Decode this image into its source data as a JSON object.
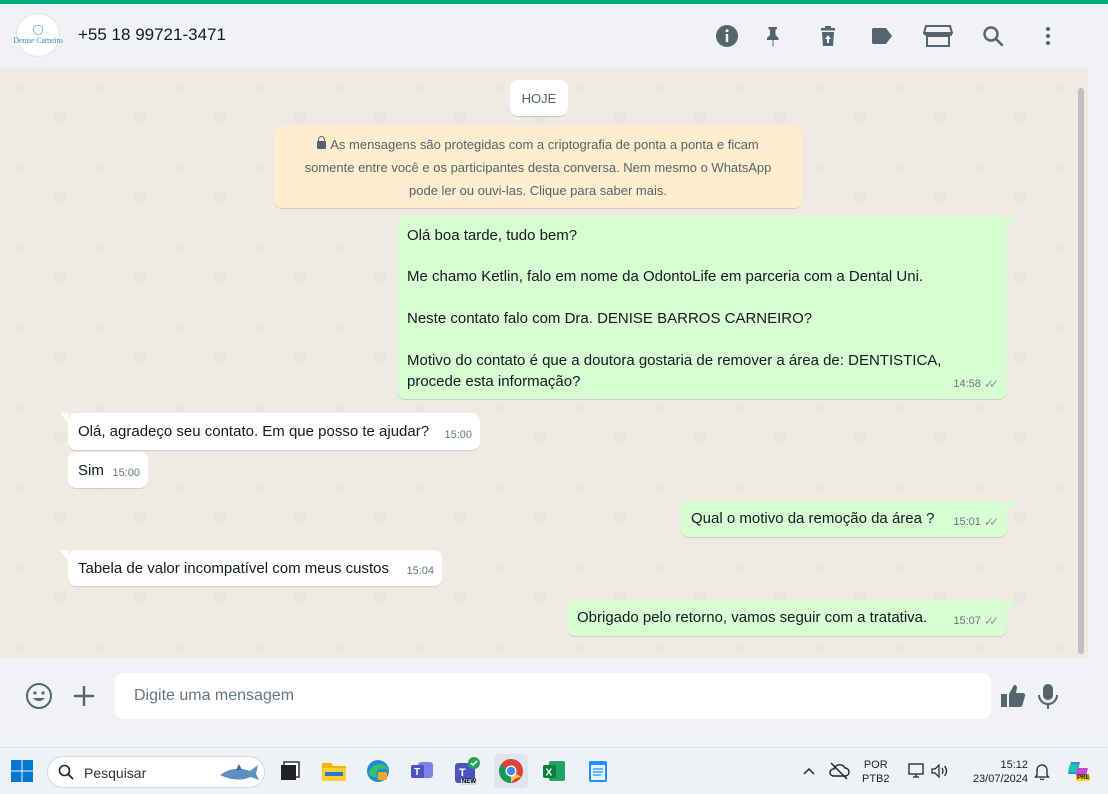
{
  "header": {
    "avatar_text": "Denise Carneiro",
    "contact_name": "+55 18 99721-3471",
    "icons": [
      "info-icon",
      "pin-icon",
      "delete-icon",
      "label-icon",
      "store-icon",
      "search-icon",
      "menu-icon"
    ]
  },
  "chat": {
    "date_label": "HOJE",
    "encryption_notice": {
      "line1": "As mensagens são protegidas com a criptografia de ponta a ponta e ficam",
      "line2": "somente entre você e os participantes desta conversa. Nem mesmo o WhatsApp",
      "line3": "pode ler ou ouvi-las. Clique para saber mais."
    },
    "messages": [
      {
        "direction": "out",
        "lines": [
          "Olá boa tarde, tudo bem?",
          "Me chamo Ketlin, falo em nome da OdontoLife em parceria com a Dental Uni.",
          "Neste contato falo com Dra. DENISE BARROS CARNEIRO?",
          "Motivo do contato é que a doutora gostaria de remover a área de: DENTISTICA,",
          "procede esta informação?"
        ],
        "time": "14:58"
      },
      {
        "direction": "in",
        "text": "Olá, agradeço seu contato. Em que posso te ajudar?",
        "time": "15:00"
      },
      {
        "direction": "in",
        "text": "Sim",
        "time": "15:00"
      },
      {
        "direction": "out",
        "text": "Qual o motivo da remoção da área ?",
        "time": "15:01"
      },
      {
        "direction": "in",
        "text": "Tabela de valor incompatível com meus custos",
        "time": "15:04"
      },
      {
        "direction": "out",
        "text": "Obrigado pelo retorno, vamos seguir com a tratativa.",
        "time": "15:07"
      }
    ]
  },
  "footer": {
    "placeholder": "Digite uma mensagem"
  },
  "taskbar": {
    "search_label": "Pesquisar",
    "language_line1": "POR",
    "language_line2": "PTB2",
    "clock_time": "15:12",
    "clock_date": "23/07/2024",
    "teams_badge": "NEW",
    "copilot_badge": "PRE"
  },
  "colors": {
    "accent": "#00a884",
    "outgoing_bubble": "#d9fdd3",
    "incoming_bubble": "#ffffff",
    "notice_bg": "#ffeecd",
    "chat_bg": "#efeae2"
  }
}
